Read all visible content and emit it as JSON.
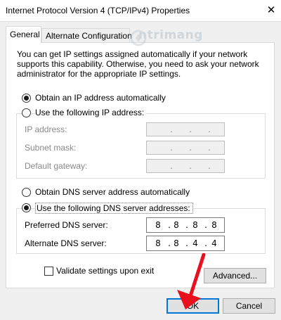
{
  "window": {
    "title": "Internet Protocol Version 4 (TCP/IPv4) Properties",
    "close_glyph": "✕"
  },
  "watermark": {
    "text": "ntrimang"
  },
  "tabs": [
    {
      "label": "General",
      "active": true
    },
    {
      "label": "Alternate Configuration",
      "active": false
    }
  ],
  "description": "You can get IP settings assigned automatically if your network supports this capability. Otherwise, you need to ask your network administrator for the appropriate IP settings.",
  "ip_section": {
    "auto_option": {
      "label": "Obtain an IP address automatically",
      "selected": true
    },
    "manual_option": {
      "label": "Use the following IP address:",
      "selected": false
    },
    "fields": [
      {
        "label": "IP address:",
        "value": [
          ".",
          ".",
          "."
        ],
        "disabled": true
      },
      {
        "label": "Subnet mask:",
        "value": [
          ".",
          ".",
          "."
        ],
        "disabled": true
      },
      {
        "label": "Default gateway:",
        "value": [
          ".",
          ".",
          "."
        ],
        "disabled": true
      }
    ]
  },
  "dns_section": {
    "auto_option": {
      "label": "Obtain DNS server address automatically",
      "selected": false
    },
    "manual_option": {
      "label": "Use the following DNS server addresses:",
      "selected": true
    },
    "fields": [
      {
        "label": "Preferred DNS server:",
        "octets": [
          "8",
          "8",
          "8",
          "8"
        ]
      },
      {
        "label": "Alternate DNS server:",
        "octets": [
          "8",
          "8",
          "4",
          "4"
        ]
      }
    ]
  },
  "validate": {
    "label": "Validate settings upon exit",
    "checked": false
  },
  "buttons": {
    "advanced": "Advanced...",
    "ok": "OK",
    "cancel": "Cancel"
  },
  "accent_colors": {
    "arrow": "#e8101c",
    "focus": "#0078d7"
  }
}
